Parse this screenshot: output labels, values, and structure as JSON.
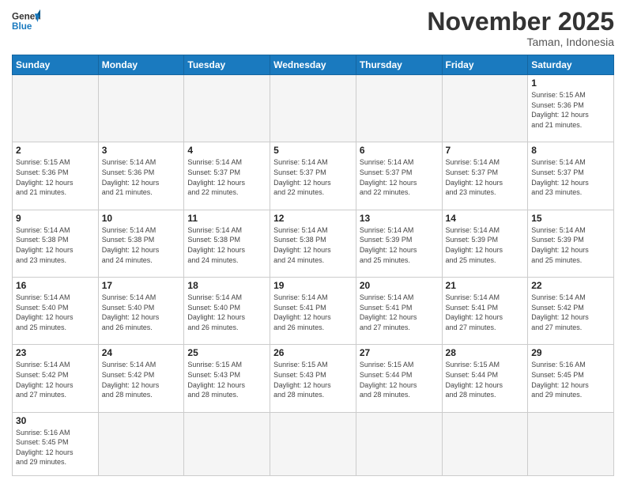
{
  "header": {
    "logo_general": "General",
    "logo_blue": "Blue",
    "month_title": "November 2025",
    "location": "Taman, Indonesia"
  },
  "weekdays": [
    "Sunday",
    "Monday",
    "Tuesday",
    "Wednesday",
    "Thursday",
    "Friday",
    "Saturday"
  ],
  "weeks": [
    [
      {
        "day": "",
        "info": "",
        "empty": true
      },
      {
        "day": "",
        "info": "",
        "empty": true
      },
      {
        "day": "",
        "info": "",
        "empty": true
      },
      {
        "day": "",
        "info": "",
        "empty": true
      },
      {
        "day": "",
        "info": "",
        "empty": true
      },
      {
        "day": "",
        "info": "",
        "empty": true
      },
      {
        "day": "1",
        "info": "Sunrise: 5:15 AM\nSunset: 5:36 PM\nDaylight: 12 hours\nand 21 minutes.",
        "empty": false
      }
    ],
    [
      {
        "day": "2",
        "info": "Sunrise: 5:15 AM\nSunset: 5:36 PM\nDaylight: 12 hours\nand 21 minutes.",
        "empty": false
      },
      {
        "day": "3",
        "info": "Sunrise: 5:14 AM\nSunset: 5:36 PM\nDaylight: 12 hours\nand 21 minutes.",
        "empty": false
      },
      {
        "day": "4",
        "info": "Sunrise: 5:14 AM\nSunset: 5:37 PM\nDaylight: 12 hours\nand 22 minutes.",
        "empty": false
      },
      {
        "day": "5",
        "info": "Sunrise: 5:14 AM\nSunset: 5:37 PM\nDaylight: 12 hours\nand 22 minutes.",
        "empty": false
      },
      {
        "day": "6",
        "info": "Sunrise: 5:14 AM\nSunset: 5:37 PM\nDaylight: 12 hours\nand 22 minutes.",
        "empty": false
      },
      {
        "day": "7",
        "info": "Sunrise: 5:14 AM\nSunset: 5:37 PM\nDaylight: 12 hours\nand 23 minutes.",
        "empty": false
      },
      {
        "day": "8",
        "info": "Sunrise: 5:14 AM\nSunset: 5:37 PM\nDaylight: 12 hours\nand 23 minutes.",
        "empty": false
      }
    ],
    [
      {
        "day": "9",
        "info": "Sunrise: 5:14 AM\nSunset: 5:38 PM\nDaylight: 12 hours\nand 23 minutes.",
        "empty": false
      },
      {
        "day": "10",
        "info": "Sunrise: 5:14 AM\nSunset: 5:38 PM\nDaylight: 12 hours\nand 24 minutes.",
        "empty": false
      },
      {
        "day": "11",
        "info": "Sunrise: 5:14 AM\nSunset: 5:38 PM\nDaylight: 12 hours\nand 24 minutes.",
        "empty": false
      },
      {
        "day": "12",
        "info": "Sunrise: 5:14 AM\nSunset: 5:38 PM\nDaylight: 12 hours\nand 24 minutes.",
        "empty": false
      },
      {
        "day": "13",
        "info": "Sunrise: 5:14 AM\nSunset: 5:39 PM\nDaylight: 12 hours\nand 25 minutes.",
        "empty": false
      },
      {
        "day": "14",
        "info": "Sunrise: 5:14 AM\nSunset: 5:39 PM\nDaylight: 12 hours\nand 25 minutes.",
        "empty": false
      },
      {
        "day": "15",
        "info": "Sunrise: 5:14 AM\nSunset: 5:39 PM\nDaylight: 12 hours\nand 25 minutes.",
        "empty": false
      }
    ],
    [
      {
        "day": "16",
        "info": "Sunrise: 5:14 AM\nSunset: 5:40 PM\nDaylight: 12 hours\nand 25 minutes.",
        "empty": false
      },
      {
        "day": "17",
        "info": "Sunrise: 5:14 AM\nSunset: 5:40 PM\nDaylight: 12 hours\nand 26 minutes.",
        "empty": false
      },
      {
        "day": "18",
        "info": "Sunrise: 5:14 AM\nSunset: 5:40 PM\nDaylight: 12 hours\nand 26 minutes.",
        "empty": false
      },
      {
        "day": "19",
        "info": "Sunrise: 5:14 AM\nSunset: 5:41 PM\nDaylight: 12 hours\nand 26 minutes.",
        "empty": false
      },
      {
        "day": "20",
        "info": "Sunrise: 5:14 AM\nSunset: 5:41 PM\nDaylight: 12 hours\nand 27 minutes.",
        "empty": false
      },
      {
        "day": "21",
        "info": "Sunrise: 5:14 AM\nSunset: 5:41 PM\nDaylight: 12 hours\nand 27 minutes.",
        "empty": false
      },
      {
        "day": "22",
        "info": "Sunrise: 5:14 AM\nSunset: 5:42 PM\nDaylight: 12 hours\nand 27 minutes.",
        "empty": false
      }
    ],
    [
      {
        "day": "23",
        "info": "Sunrise: 5:14 AM\nSunset: 5:42 PM\nDaylight: 12 hours\nand 27 minutes.",
        "empty": false
      },
      {
        "day": "24",
        "info": "Sunrise: 5:14 AM\nSunset: 5:42 PM\nDaylight: 12 hours\nand 28 minutes.",
        "empty": false
      },
      {
        "day": "25",
        "info": "Sunrise: 5:15 AM\nSunset: 5:43 PM\nDaylight: 12 hours\nand 28 minutes.",
        "empty": false
      },
      {
        "day": "26",
        "info": "Sunrise: 5:15 AM\nSunset: 5:43 PM\nDaylight: 12 hours\nand 28 minutes.",
        "empty": false
      },
      {
        "day": "27",
        "info": "Sunrise: 5:15 AM\nSunset: 5:44 PM\nDaylight: 12 hours\nand 28 minutes.",
        "empty": false
      },
      {
        "day": "28",
        "info": "Sunrise: 5:15 AM\nSunset: 5:44 PM\nDaylight: 12 hours\nand 28 minutes.",
        "empty": false
      },
      {
        "day": "29",
        "info": "Sunrise: 5:16 AM\nSunset: 5:45 PM\nDaylight: 12 hours\nand 29 minutes.",
        "empty": false
      }
    ],
    [
      {
        "day": "30",
        "info": "Sunrise: 5:16 AM\nSunset: 5:45 PM\nDaylight: 12 hours\nand 29 minutes.",
        "empty": false
      },
      {
        "day": "",
        "info": "",
        "empty": true
      },
      {
        "day": "",
        "info": "",
        "empty": true
      },
      {
        "day": "",
        "info": "",
        "empty": true
      },
      {
        "day": "",
        "info": "",
        "empty": true
      },
      {
        "day": "",
        "info": "",
        "empty": true
      },
      {
        "day": "",
        "info": "",
        "empty": true
      }
    ]
  ]
}
